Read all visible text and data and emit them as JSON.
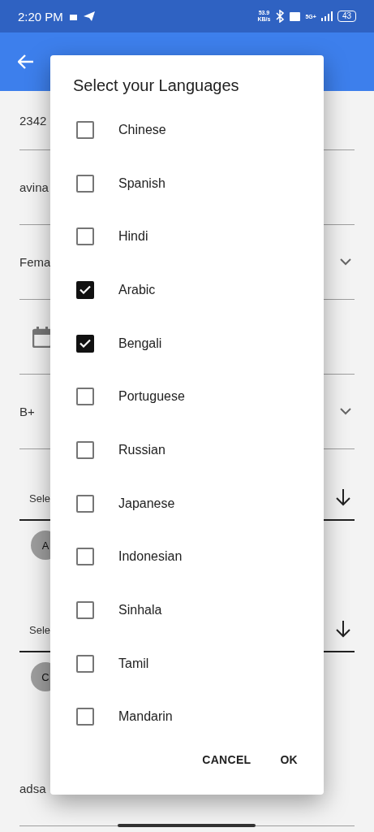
{
  "status_bar": {
    "time": "2:20 PM",
    "speed": "53.9",
    "speed_unit": "KB/s",
    "network": "5G+",
    "battery": "43"
  },
  "background_form": {
    "fields": [
      {
        "kind": "text",
        "value": "2342"
      },
      {
        "kind": "text",
        "value": "avina"
      },
      {
        "kind": "dropdown",
        "value": "Fema"
      },
      {
        "kind": "date"
      },
      {
        "kind": "dropdown",
        "value": "B+"
      },
      {
        "kind": "multiselect",
        "value": "Sele",
        "chip": "A"
      },
      {
        "kind": "multiselect",
        "value": "Sele",
        "chip": "C"
      },
      {
        "kind": "text",
        "value": "adsa"
      }
    ]
  },
  "dialog": {
    "title": "Select your Languages",
    "options": [
      {
        "label": "Chinese",
        "checked": false
      },
      {
        "label": "Spanish",
        "checked": false
      },
      {
        "label": "Hindi",
        "checked": false
      },
      {
        "label": "Arabic",
        "checked": true
      },
      {
        "label": "Bengali",
        "checked": true
      },
      {
        "label": "Portuguese",
        "checked": false
      },
      {
        "label": "Russian",
        "checked": false
      },
      {
        "label": "Japanese",
        "checked": false
      },
      {
        "label": "Indonesian",
        "checked": false
      },
      {
        "label": "Sinhala",
        "checked": false
      },
      {
        "label": "Tamil",
        "checked": false
      },
      {
        "label": "Mandarin",
        "checked": false
      }
    ],
    "buttons": [
      "CANCEL",
      "OK"
    ]
  }
}
